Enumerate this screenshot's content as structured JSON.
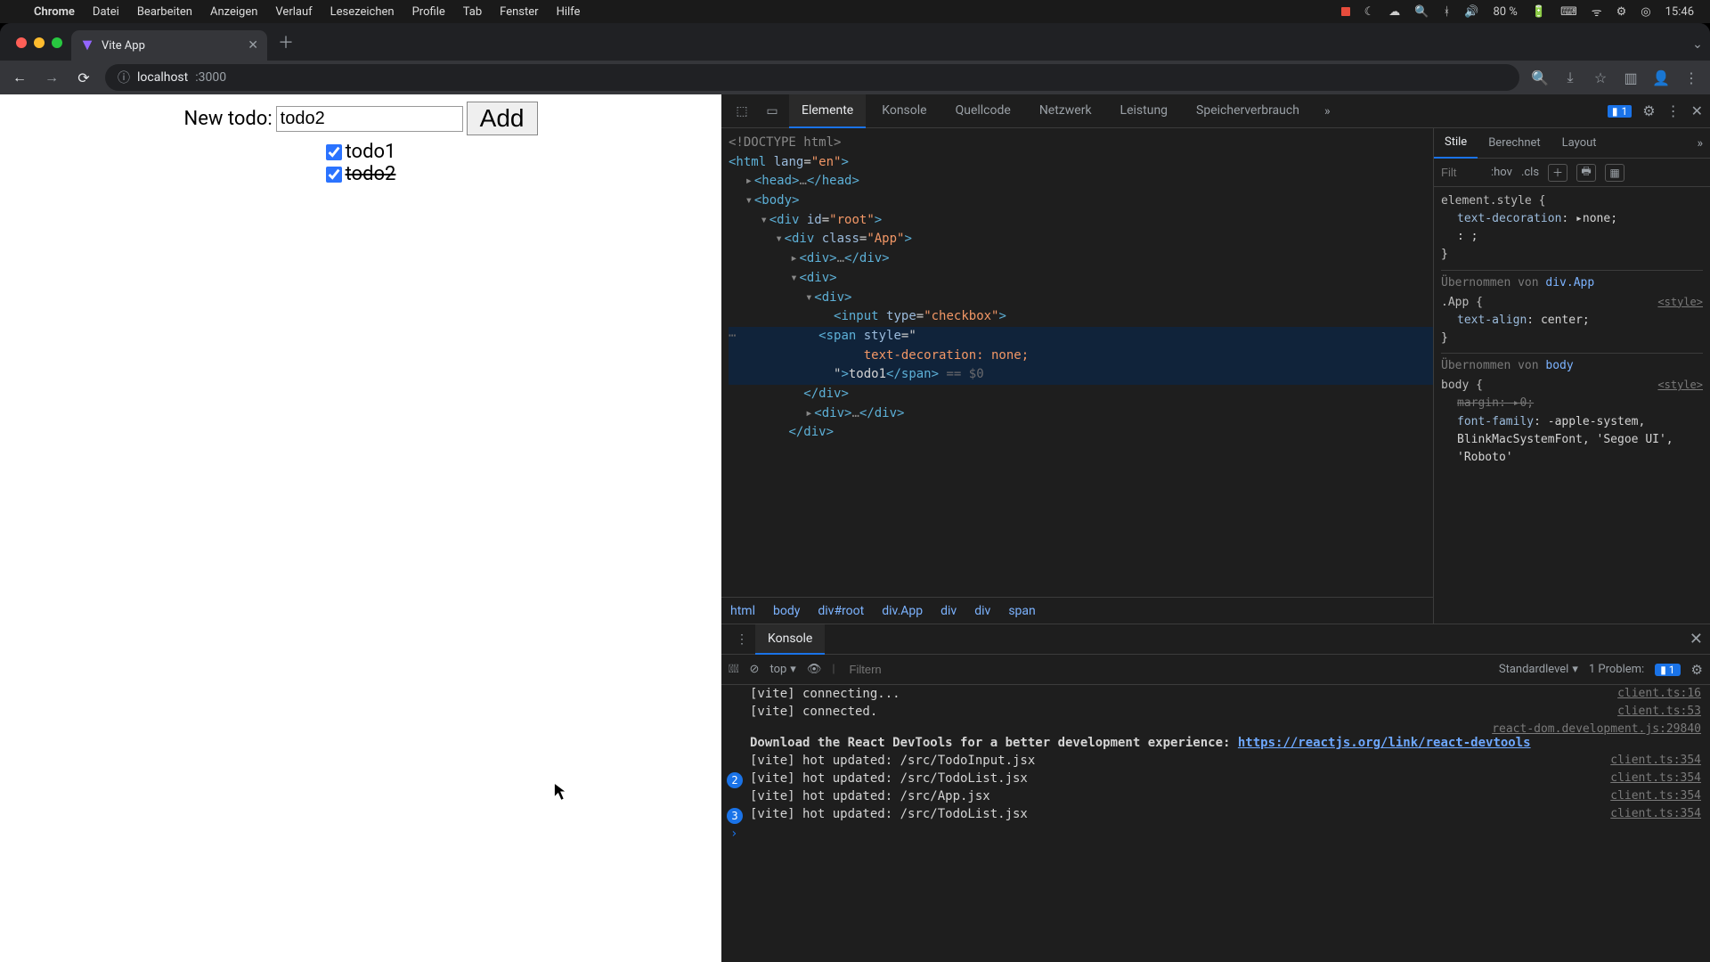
{
  "mac_menu": {
    "app": "Chrome",
    "items": [
      "Datei",
      "Bearbeiten",
      "Anzeigen",
      "Verlauf",
      "Lesezeichen",
      "Profile",
      "Tab",
      "Fenster",
      "Hilfe"
    ],
    "battery": "80 %",
    "time": "15:46"
  },
  "browser": {
    "tab_title": "Vite App",
    "url_host": "localhost",
    "url_path": ":3000"
  },
  "app": {
    "new_todo_label": "New todo:",
    "input_value": "todo2",
    "add_button": "Add",
    "todos": [
      {
        "label": "todo1",
        "checked": true,
        "struck": false
      },
      {
        "label": "todo2",
        "checked": true,
        "struck": true
      }
    ]
  },
  "devtools": {
    "tabs": [
      "Elemente",
      "Konsole",
      "Quellcode",
      "Netzwerk",
      "Leistung",
      "Speicherverbrauch"
    ],
    "active_tab": "Elemente",
    "issue_count": "1",
    "crumbs": [
      "html",
      "body",
      "div#root",
      "div.App",
      "div",
      "div",
      "span"
    ],
    "dom": {
      "doctype": "<!DOCTYPE html>",
      "html_open": "<html lang=\"en\">",
      "head": "<head>…</head>",
      "body_open": "<body>",
      "root_open": "<div id=\"root\">",
      "app_open": "<div class=\"App\">",
      "firstdiv": "<div>…</div>",
      "wrap_open": "<div>",
      "item_open": "<div>",
      "checkbox": "<input type=\"checkbox\">",
      "span_open": "<span style=\"",
      "span_style": "text-decoration: none;",
      "span_close_text": "\">todo1</span>",
      "eq_dollar": " == $0",
      "item_close": "</div>",
      "seconddiv": "<div>…</div>",
      "wrap_close": "</div>"
    },
    "styles": {
      "tabs": [
        "Stile",
        "Berechnet",
        "Layout"
      ],
      "filter_placeholder": "Filt",
      "hov": ":hov",
      "cls": ".cls",
      "element_style": {
        "selector": "element.style {",
        "props": [
          {
            "k": "text-decoration",
            "v": "none;"
          },
          {
            "k": "",
            "v": ": ;"
          }
        ],
        "close": "}"
      },
      "inherited1_label": "Übernommen von",
      "inherited1_from": "div.App",
      "app_rule": {
        "selector": ".App {",
        "origin": "<style>",
        "props": [
          {
            "k": "text-align",
            "v": "center;"
          }
        ],
        "close": "}"
      },
      "inherited2_label": "Übernommen von",
      "inherited2_from": "body",
      "body_rule": {
        "selector": "body {",
        "origin": "<style>",
        "margin": {
          "k": "margin",
          "v": "0;"
        },
        "font": {
          "k": "font-family",
          "v": "-apple-system, BlinkMacSystemFont, 'Segoe UI', 'Roboto'"
        },
        "close": "}"
      }
    },
    "console": {
      "drawer_tab": "Konsole",
      "context": "top",
      "filter_placeholder": "Filtern",
      "level": "Standardlevel",
      "problems_label": "1 Problem:",
      "problems_count": "1",
      "logs": [
        {
          "count": "",
          "msg": "[vite] connecting...",
          "src": "client.ts:16"
        },
        {
          "count": "",
          "msg": "[vite] connected.",
          "src": "client.ts:53"
        },
        {
          "count": "",
          "msg_prefix": "Download the React DevTools for a better development experience: ",
          "link": "https://reactjs.org/link/react-devtools",
          "src": "react-dom.development.js:29840",
          "bold": true
        },
        {
          "count": "",
          "msg": "[vite] hot updated: /src/TodoInput.jsx",
          "src": "client.ts:354"
        },
        {
          "count": "2",
          "msg": "[vite] hot updated: /src/TodoList.jsx",
          "src": "client.ts:354"
        },
        {
          "count": "",
          "msg": "[vite] hot updated: /src/App.jsx",
          "src": "client.ts:354"
        },
        {
          "count": "3",
          "msg": "[vite] hot updated: /src/TodoList.jsx",
          "src": "client.ts:354"
        }
      ]
    }
  }
}
